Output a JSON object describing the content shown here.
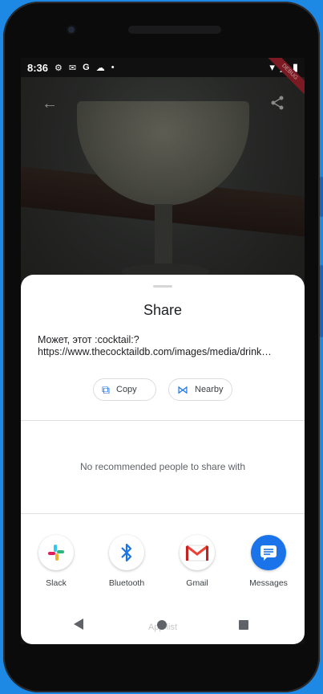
{
  "status": {
    "time": "8:36",
    "icons": [
      "settings-icon",
      "gmail-icon",
      "google-icon",
      "cloud-icon",
      "dot-icon"
    ],
    "right_icons": [
      "wifi-icon",
      "signal-icon",
      "battery-icon"
    ]
  },
  "toolbar": {
    "back_icon": "←",
    "share_icon": "share-icon"
  },
  "debug_banner": "DEBUG",
  "sheet": {
    "title": "Share",
    "preview_line1": "Может, этот :cocktail:?",
    "preview_line2": "https://www.thecocktaildb.com/images/media/drink…",
    "copy_label": "Copy",
    "nearby_label": "Nearby",
    "no_people": "No recommended people to share with",
    "apps": [
      {
        "label": "Slack",
        "icon": "slack-icon"
      },
      {
        "label": "Bluetooth",
        "icon": "bluetooth-icon"
      },
      {
        "label": "Gmail",
        "icon": "gmail-icon"
      },
      {
        "label": "Messages",
        "icon": "messages-icon"
      }
    ],
    "ghost_text": "App list"
  },
  "colors": {
    "accent": "#1a73e8",
    "messages_bg": "#1a73e8",
    "gmail_red": "#ea4335",
    "bluetooth": "#1a73e8"
  }
}
